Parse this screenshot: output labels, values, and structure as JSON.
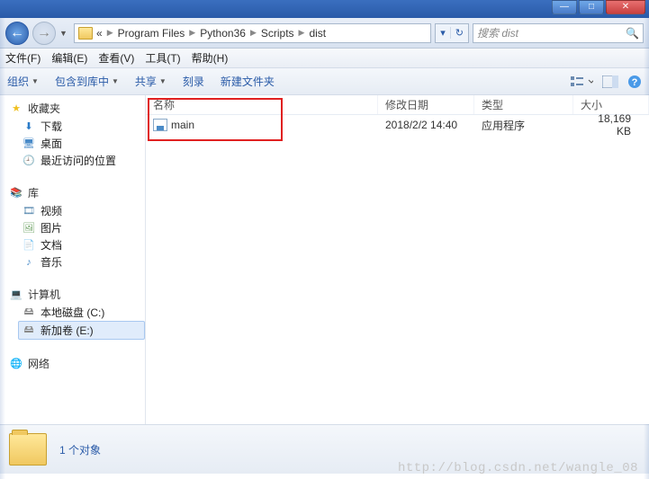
{
  "title_buttons": {
    "min": "—",
    "max": "□",
    "close": "✕"
  },
  "breadcrumb": {
    "ellipsis": "«",
    "items": [
      "Program Files",
      "Python36",
      "Scripts",
      "dist"
    ]
  },
  "search": {
    "placeholder": "搜索 dist"
  },
  "refresh": {
    "down": "▾",
    "icon": "↻"
  },
  "menubar": {
    "file": "文件(F)",
    "edit": "编辑(E)",
    "view": "查看(V)",
    "tools": "工具(T)",
    "help": "帮助(H)"
  },
  "toolbar": {
    "organize": "组织",
    "include": "包含到库中",
    "share": "共享",
    "burn": "刻录",
    "newfolder": "新建文件夹"
  },
  "columns": {
    "name": "名称",
    "date": "修改日期",
    "type": "类型",
    "size": "大小"
  },
  "files": [
    {
      "name": "main",
      "date": "2018/2/2 14:40",
      "type": "应用程序",
      "size": "18,169 KB"
    }
  ],
  "sidebar": {
    "favorites": "收藏夹",
    "downloads": "下载",
    "desktop": "桌面",
    "recent": "最近访问的位置",
    "libraries": "库",
    "videos": "视频",
    "pictures": "图片",
    "documents": "文档",
    "music": "音乐",
    "computer": "计算机",
    "disk_c": "本地磁盘 (C:)",
    "disk_e": "新加卷 (E:)",
    "network": "网络"
  },
  "status": {
    "count": "1 个对象"
  },
  "watermark": "http://blog.csdn.net/wangle_08"
}
